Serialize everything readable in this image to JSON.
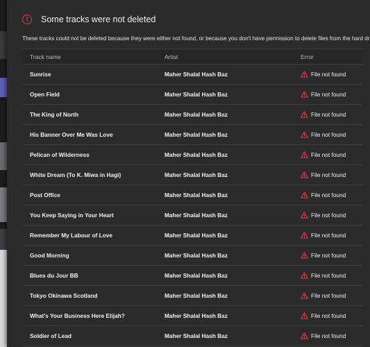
{
  "dialog": {
    "title": "Some tracks were not deleted",
    "description": "These tracks could not be deleted because they were either not found, or because you don't have permission to delete files from the hard drive."
  },
  "table": {
    "headers": {
      "track": "Track name",
      "artist": "Artist",
      "error": "Error"
    },
    "rows": [
      {
        "track": "Sunrise",
        "artist": "Maher Shalal Hash Baz",
        "error": "File not found"
      },
      {
        "track": "Open Field",
        "artist": "Maher Shalal Hash Baz",
        "error": "File not found"
      },
      {
        "track": "The King of North",
        "artist": "Maher Shalal Hash Baz",
        "error": "File not found"
      },
      {
        "track": "His Banner Over Me Was Love",
        "artist": "Maher Shalal Hash Baz",
        "error": "File not found"
      },
      {
        "track": "Pelican of Wilderness",
        "artist": "Maher Shalal Hash Baz",
        "error": "File not found"
      },
      {
        "track": "White Dream (To K. Miwa in Hagi)",
        "artist": "Maher Shalal Hash Baz",
        "error": "File not found"
      },
      {
        "track": "Post Office",
        "artist": "Maher Shalal Hash Baz",
        "error": "File not found"
      },
      {
        "track": "You Keep Saying in Your Heart",
        "artist": "Maher Shalal Hash Baz",
        "error": "File not found"
      },
      {
        "track": "Remember My Labour of Love",
        "artist": "Maher Shalal Hash Baz",
        "error": "File not found"
      },
      {
        "track": "Good Morning",
        "artist": "Maher Shalal Hash Baz",
        "error": "File not found"
      },
      {
        "track": "Blues du Jour BB",
        "artist": "Maher Shalal Hash Baz",
        "error": "File not found"
      },
      {
        "track": "Tokyo Okinawa Scotland",
        "artist": "Maher Shalal Hash Baz",
        "error": "File not found"
      },
      {
        "track": "What's Your Business Here Elijah?",
        "artist": "Maher Shalal Hash Baz",
        "error": "File not found"
      },
      {
        "track": "Soldier of Lead",
        "artist": "Maher Shalal Hash Baz",
        "error": "File not found"
      }
    ]
  },
  "colors": {
    "accent_error": "#e0364c",
    "dialog_bg": "#2b2b2c"
  },
  "icons": {
    "header": "error-circle-icon",
    "row": "warning-triangle-icon"
  }
}
